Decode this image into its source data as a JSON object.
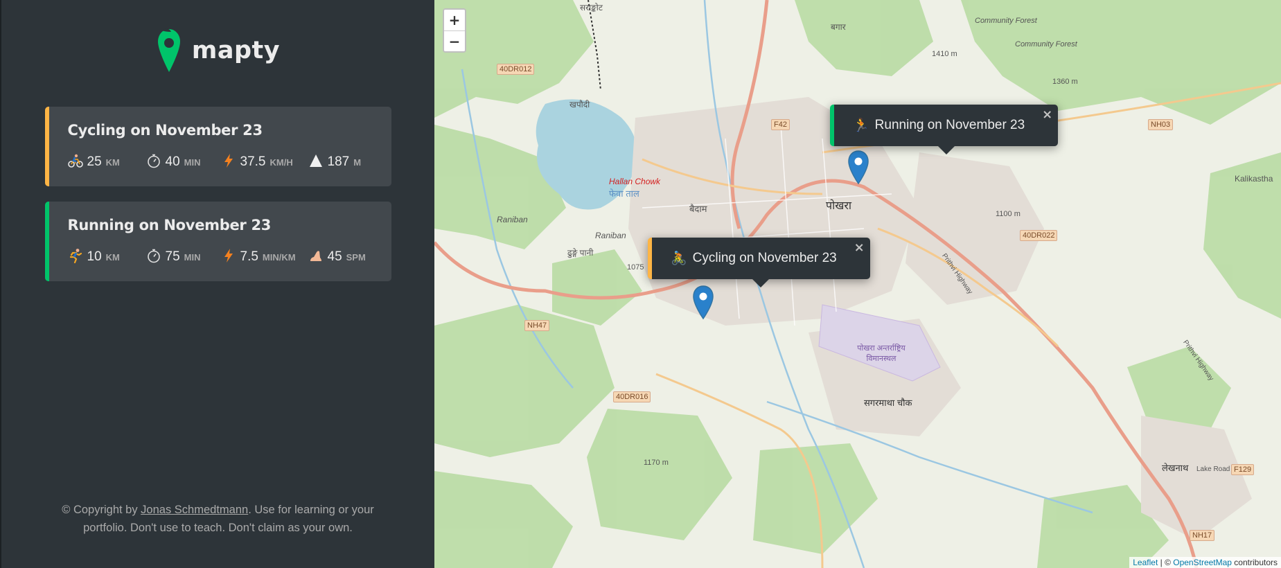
{
  "brand": {
    "name": "mapty",
    "accent": "#00c46a"
  },
  "workouts": [
    {
      "type": "cycling",
      "title": "Cycling on November 23",
      "distance": "25",
      "distance_unit": "km",
      "duration": "40",
      "duration_unit": "min",
      "speed": "37.5",
      "speed_unit": "km/h",
      "elevation": "187",
      "elevation_unit": "m",
      "color": "#ffb545"
    },
    {
      "type": "running",
      "title": "Running on November 23",
      "distance": "10",
      "distance_unit": "km",
      "duration": "75",
      "duration_unit": "min",
      "pace": "7.5",
      "pace_unit": "min/km",
      "cadence": "45",
      "cadence_unit": "spm",
      "color": "#00c46a"
    }
  ],
  "footer": {
    "prefix": "© Copyright by ",
    "author": "Jonas Schmedtmann",
    "suffix": ". Use for learning or your portfolio. Don't use to teach. Don't claim as your own."
  },
  "map": {
    "zoom_in": "+",
    "zoom_out": "−",
    "popups": [
      {
        "type": "running",
        "icon": "🏃",
        "label": "Running on November 23",
        "close": "×"
      },
      {
        "type": "cycling",
        "icon": "🚴",
        "label": "Cycling on November 23",
        "close": "×"
      }
    ],
    "labels": {
      "pokhara": "पोखरा",
      "baidam": "बैदाम",
      "hallan_chowk": "Hallan Chowk",
      "raniban": "Raniban",
      "raniban2": "Raniban",
      "fewa_lake": "फेवा ताल",
      "khapaudi": "खपौदी",
      "sarangkot": "सराङ्कोट",
      "bagar": "बगार",
      "airport": "पोखरा अन्तर्राष्ट्रिय विमानस्थल",
      "sagarmatha": "सगरमाथा चौक",
      "lekhnath": "लेखनाथ",
      "community_forest1": "Community Forest",
      "community_forest2": "Community Forest",
      "kalikastha": "Kalikastha",
      "dhungepani": "ढुङ्गे पानी",
      "m1410": "1410 m",
      "m1360": "1360 m",
      "m1100": "1100 m",
      "m1170": "1170 m",
      "m1075": "1075",
      "prithvi_highway": "Prithvi Highway",
      "prithvi_highway2": "Prithvi Highway",
      "lake_road": "Lake Road"
    },
    "roads": {
      "r40dr012": "40DR012",
      "rf42": "F42",
      "rnh03": "NH03",
      "r40dr022": "40DR022",
      "rnh47": "NH47",
      "r40dr016": "40DR016",
      "rf129": "F129",
      "rnh17": "NH17"
    },
    "attribution": {
      "leaflet": "Leaflet",
      "sep": " | © ",
      "osm": "OpenStreetMap",
      "suffix": " contributors"
    }
  }
}
